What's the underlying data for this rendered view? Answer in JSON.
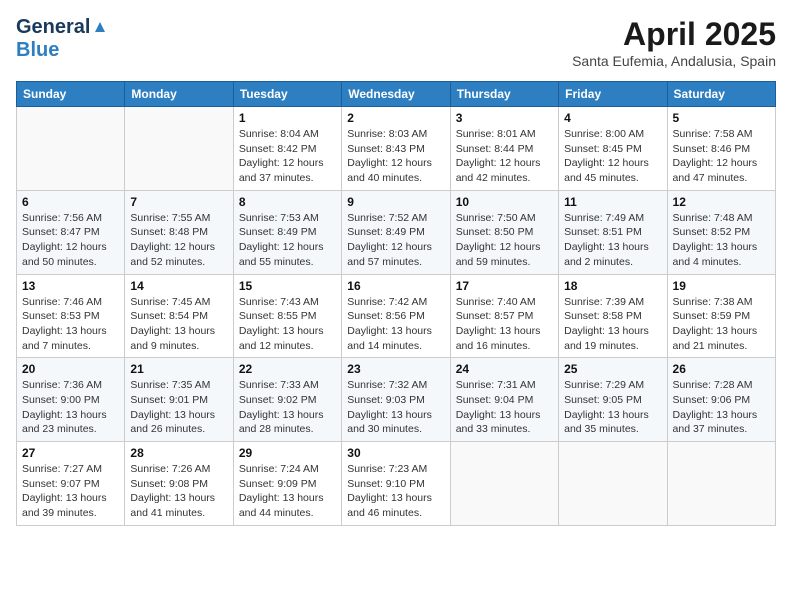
{
  "header": {
    "logo_general": "General",
    "logo_blue": "Blue",
    "title": "April 2025",
    "subtitle": "Santa Eufemia, Andalusia, Spain"
  },
  "weekdays": [
    "Sunday",
    "Monday",
    "Tuesday",
    "Wednesday",
    "Thursday",
    "Friday",
    "Saturday"
  ],
  "weeks": [
    [
      {
        "day": "",
        "sunrise": "",
        "sunset": "",
        "daylight": ""
      },
      {
        "day": "",
        "sunrise": "",
        "sunset": "",
        "daylight": ""
      },
      {
        "day": "1",
        "sunrise": "Sunrise: 8:04 AM",
        "sunset": "Sunset: 8:42 PM",
        "daylight": "Daylight: 12 hours and 37 minutes."
      },
      {
        "day": "2",
        "sunrise": "Sunrise: 8:03 AM",
        "sunset": "Sunset: 8:43 PM",
        "daylight": "Daylight: 12 hours and 40 minutes."
      },
      {
        "day": "3",
        "sunrise": "Sunrise: 8:01 AM",
        "sunset": "Sunset: 8:44 PM",
        "daylight": "Daylight: 12 hours and 42 minutes."
      },
      {
        "day": "4",
        "sunrise": "Sunrise: 8:00 AM",
        "sunset": "Sunset: 8:45 PM",
        "daylight": "Daylight: 12 hours and 45 minutes."
      },
      {
        "day": "5",
        "sunrise": "Sunrise: 7:58 AM",
        "sunset": "Sunset: 8:46 PM",
        "daylight": "Daylight: 12 hours and 47 minutes."
      }
    ],
    [
      {
        "day": "6",
        "sunrise": "Sunrise: 7:56 AM",
        "sunset": "Sunset: 8:47 PM",
        "daylight": "Daylight: 12 hours and 50 minutes."
      },
      {
        "day": "7",
        "sunrise": "Sunrise: 7:55 AM",
        "sunset": "Sunset: 8:48 PM",
        "daylight": "Daylight: 12 hours and 52 minutes."
      },
      {
        "day": "8",
        "sunrise": "Sunrise: 7:53 AM",
        "sunset": "Sunset: 8:49 PM",
        "daylight": "Daylight: 12 hours and 55 minutes."
      },
      {
        "day": "9",
        "sunrise": "Sunrise: 7:52 AM",
        "sunset": "Sunset: 8:49 PM",
        "daylight": "Daylight: 12 hours and 57 minutes."
      },
      {
        "day": "10",
        "sunrise": "Sunrise: 7:50 AM",
        "sunset": "Sunset: 8:50 PM",
        "daylight": "Daylight: 12 hours and 59 minutes."
      },
      {
        "day": "11",
        "sunrise": "Sunrise: 7:49 AM",
        "sunset": "Sunset: 8:51 PM",
        "daylight": "Daylight: 13 hours and 2 minutes."
      },
      {
        "day": "12",
        "sunrise": "Sunrise: 7:48 AM",
        "sunset": "Sunset: 8:52 PM",
        "daylight": "Daylight: 13 hours and 4 minutes."
      }
    ],
    [
      {
        "day": "13",
        "sunrise": "Sunrise: 7:46 AM",
        "sunset": "Sunset: 8:53 PM",
        "daylight": "Daylight: 13 hours and 7 minutes."
      },
      {
        "day": "14",
        "sunrise": "Sunrise: 7:45 AM",
        "sunset": "Sunset: 8:54 PM",
        "daylight": "Daylight: 13 hours and 9 minutes."
      },
      {
        "day": "15",
        "sunrise": "Sunrise: 7:43 AM",
        "sunset": "Sunset: 8:55 PM",
        "daylight": "Daylight: 13 hours and 12 minutes."
      },
      {
        "day": "16",
        "sunrise": "Sunrise: 7:42 AM",
        "sunset": "Sunset: 8:56 PM",
        "daylight": "Daylight: 13 hours and 14 minutes."
      },
      {
        "day": "17",
        "sunrise": "Sunrise: 7:40 AM",
        "sunset": "Sunset: 8:57 PM",
        "daylight": "Daylight: 13 hours and 16 minutes."
      },
      {
        "day": "18",
        "sunrise": "Sunrise: 7:39 AM",
        "sunset": "Sunset: 8:58 PM",
        "daylight": "Daylight: 13 hours and 19 minutes."
      },
      {
        "day": "19",
        "sunrise": "Sunrise: 7:38 AM",
        "sunset": "Sunset: 8:59 PM",
        "daylight": "Daylight: 13 hours and 21 minutes."
      }
    ],
    [
      {
        "day": "20",
        "sunrise": "Sunrise: 7:36 AM",
        "sunset": "Sunset: 9:00 PM",
        "daylight": "Daylight: 13 hours and 23 minutes."
      },
      {
        "day": "21",
        "sunrise": "Sunrise: 7:35 AM",
        "sunset": "Sunset: 9:01 PM",
        "daylight": "Daylight: 13 hours and 26 minutes."
      },
      {
        "day": "22",
        "sunrise": "Sunrise: 7:33 AM",
        "sunset": "Sunset: 9:02 PM",
        "daylight": "Daylight: 13 hours and 28 minutes."
      },
      {
        "day": "23",
        "sunrise": "Sunrise: 7:32 AM",
        "sunset": "Sunset: 9:03 PM",
        "daylight": "Daylight: 13 hours and 30 minutes."
      },
      {
        "day": "24",
        "sunrise": "Sunrise: 7:31 AM",
        "sunset": "Sunset: 9:04 PM",
        "daylight": "Daylight: 13 hours and 33 minutes."
      },
      {
        "day": "25",
        "sunrise": "Sunrise: 7:29 AM",
        "sunset": "Sunset: 9:05 PM",
        "daylight": "Daylight: 13 hours and 35 minutes."
      },
      {
        "day": "26",
        "sunrise": "Sunrise: 7:28 AM",
        "sunset": "Sunset: 9:06 PM",
        "daylight": "Daylight: 13 hours and 37 minutes."
      }
    ],
    [
      {
        "day": "27",
        "sunrise": "Sunrise: 7:27 AM",
        "sunset": "Sunset: 9:07 PM",
        "daylight": "Daylight: 13 hours and 39 minutes."
      },
      {
        "day": "28",
        "sunrise": "Sunrise: 7:26 AM",
        "sunset": "Sunset: 9:08 PM",
        "daylight": "Daylight: 13 hours and 41 minutes."
      },
      {
        "day": "29",
        "sunrise": "Sunrise: 7:24 AM",
        "sunset": "Sunset: 9:09 PM",
        "daylight": "Daylight: 13 hours and 44 minutes."
      },
      {
        "day": "30",
        "sunrise": "Sunrise: 7:23 AM",
        "sunset": "Sunset: 9:10 PM",
        "daylight": "Daylight: 13 hours and 46 minutes."
      },
      {
        "day": "",
        "sunrise": "",
        "sunset": "",
        "daylight": ""
      },
      {
        "day": "",
        "sunrise": "",
        "sunset": "",
        "daylight": ""
      },
      {
        "day": "",
        "sunrise": "",
        "sunset": "",
        "daylight": ""
      }
    ]
  ]
}
